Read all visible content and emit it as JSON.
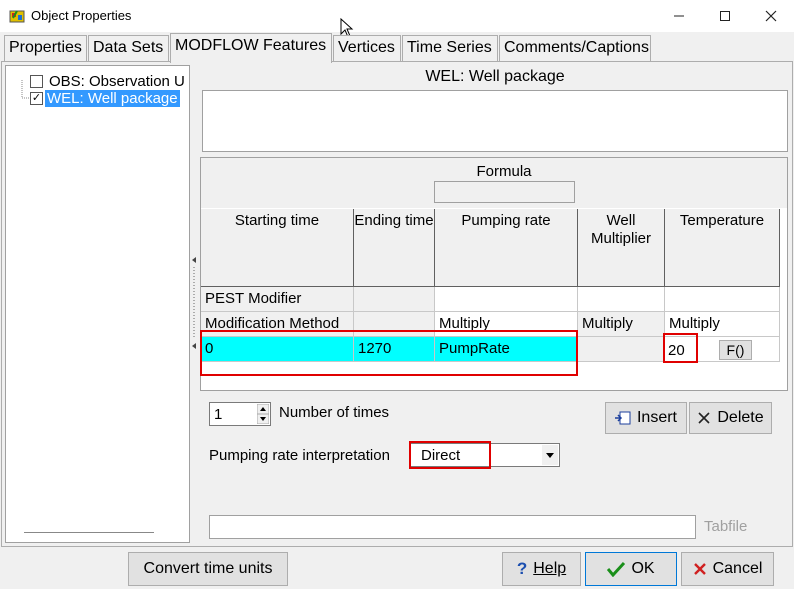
{
  "window": {
    "title": "Object Properties"
  },
  "tabs": [
    "Properties",
    "Data Sets",
    "MODFLOW Features",
    "Vertices",
    "Time Series",
    "Comments/Captions"
  ],
  "tree": {
    "items": [
      {
        "label": "OBS: Observation U",
        "checked": false
      },
      {
        "label": "WEL: Well package",
        "checked": true,
        "selected": true
      }
    ]
  },
  "package_title": "WEL: Well package",
  "formula_label": "Formula",
  "grid": {
    "headers": [
      "Starting time",
      "Ending time",
      "Pumping rate",
      "Well Multiplier",
      "Temperature"
    ],
    "pest_modifier_label": "PEST Modifier",
    "modification_method_label": "Modification Method",
    "modification_methods": [
      "Multiply",
      "Multiply",
      "Multiply"
    ],
    "row": {
      "starting_time": "0",
      "ending_time": "1270",
      "pumping_rate": "PumpRate",
      "temperature": "20",
      "formula_button": "F()"
    }
  },
  "number_of_times": {
    "value": "1",
    "label": "Number of times"
  },
  "insert_button": "Insert",
  "delete_button": "Delete",
  "pumping_rate_interpretation": {
    "label": "Pumping rate interpretation",
    "value": "Direct"
  },
  "tabfile_label": "Tabfile",
  "bottom": {
    "convert_button": "Convert time units",
    "help_button": "Help",
    "ok_button": "OK",
    "cancel_button": "Cancel"
  },
  "colors": {
    "selection": "#3399ff",
    "highlight_row": "#00ffff",
    "callout": "#e00000",
    "ok_check": "#1a8f1a",
    "cancel_x": "#d02020",
    "help_q": "#1c4fb0"
  }
}
